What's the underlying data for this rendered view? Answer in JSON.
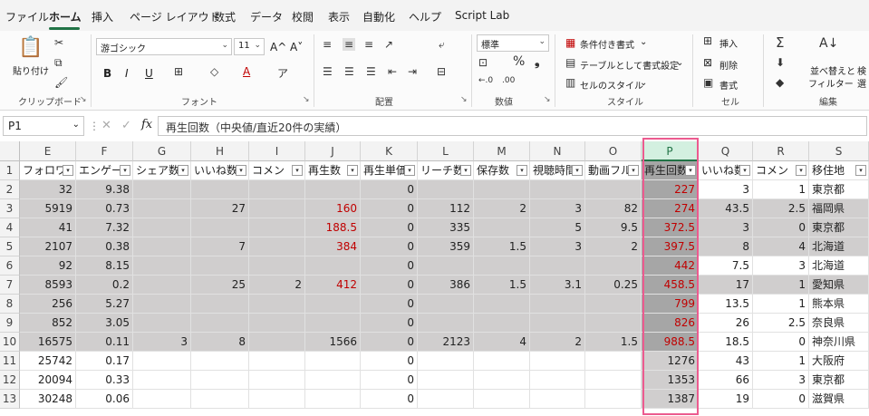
{
  "menu": [
    "ファイル",
    "ホーム",
    "挿入",
    "ページ レイアウト",
    "数式",
    "データ",
    "校閲",
    "表示",
    "自動化",
    "ヘルプ",
    "Script Lab"
  ],
  "menu_active": "ホーム",
  "ribbon": {
    "clipboard": {
      "label": "クリップボード",
      "paste": "貼り付け"
    },
    "font": {
      "label": "フォント",
      "name": "游ゴシック",
      "size": "11",
      "grow": "A^",
      "shrink": "A˅",
      "bold": "B",
      "italic": "I",
      "underline": "U"
    },
    "alignment": {
      "label": "配置"
    },
    "number": {
      "label": "数値",
      "format": "標準"
    },
    "styles": {
      "label": "スタイル",
      "cond": "条件付き書式",
      "table": "テーブルとして書式設定",
      "cell": "セルのスタイル"
    },
    "cells": {
      "label": "セル",
      "insert": "挿入",
      "delete": "削除",
      "format": "書式"
    },
    "editing": {
      "label": "編集",
      "sort1": "並べ替えと",
      "sort2": "フィルター",
      "find": "検",
      "find2": "選"
    }
  },
  "formula_bar": {
    "cell_ref": "P1",
    "fx": "fx",
    "content": "再生回数（中央値/直近20件の実績）"
  },
  "columns": [
    "E",
    "F",
    "G",
    "H",
    "I",
    "J",
    "K",
    "L",
    "M",
    "N",
    "O",
    "P",
    "Q",
    "R",
    "S"
  ],
  "selected_column": "P",
  "headers": [
    "フォロワ",
    "エンゲー",
    "シェア数",
    "いいね数",
    "コメン",
    "再生数",
    "再生単価",
    "リーチ数",
    "保存数",
    "視聴時間",
    "動画フル",
    "再生回数",
    "いいね数",
    "コメン",
    "移住地"
  ],
  "rows": [
    {
      "n": "1"
    },
    {
      "n": "2",
      "E": "32",
      "F": "9.38",
      "K": "0",
      "P": "227",
      "Q": "3",
      "R": "1",
      "S": "東京都"
    },
    {
      "n": "3",
      "E": "5919",
      "F": "0.73",
      "H": "27",
      "J": "160",
      "K": "0",
      "L": "112",
      "M": "2",
      "N": "3",
      "O": "82",
      "P": "274",
      "Q": "43.5",
      "R": "2.5",
      "S": "福岡県"
    },
    {
      "n": "4",
      "E": "41",
      "F": "7.32",
      "J": "188.5",
      "K": "0",
      "L": "335",
      "N": "5",
      "O": "9.5",
      "P": "372.5",
      "Q": "3",
      "R": "0",
      "S": "東京都"
    },
    {
      "n": "5",
      "E": "2107",
      "F": "0.38",
      "H": "7",
      "J": "384",
      "K": "0",
      "L": "359",
      "M": "1.5",
      "N": "3",
      "O": "2",
      "P": "397.5",
      "Q": "8",
      "R": "4",
      "S": "北海道"
    },
    {
      "n": "6",
      "E": "92",
      "F": "8.15",
      "K": "0",
      "P": "442",
      "Q": "7.5",
      "R": "3",
      "S": "北海道"
    },
    {
      "n": "7",
      "E": "8593",
      "F": "0.2",
      "H": "25",
      "I": "2",
      "J": "412",
      "K": "0",
      "L": "386",
      "M": "1.5",
      "N": "3.1",
      "O": "0.25",
      "P": "458.5",
      "Q": "17",
      "R": "1",
      "S": "愛知県"
    },
    {
      "n": "8",
      "E": "256",
      "F": "5.27",
      "K": "0",
      "P": "799",
      "Q": "13.5",
      "R": "1",
      "S": "熊本県"
    },
    {
      "n": "9",
      "E": "852",
      "F": "3.05",
      "K": "0",
      "P": "826",
      "Q": "26",
      "R": "2.5",
      "S": "奈良県"
    },
    {
      "n": "10",
      "E": "16575",
      "F": "0.11",
      "G": "3",
      "H": "8",
      "J": "1566",
      "K": "0",
      "L": "2123",
      "M": "4",
      "N": "2",
      "O": "1.5",
      "P": "988.5",
      "Q": "18.5",
      "R": "0",
      "S": "神奈川県"
    },
    {
      "n": "11",
      "E": "25742",
      "F": "0.17",
      "K": "0",
      "P": "1276",
      "Q": "43",
      "R": "1",
      "S": "大阪府"
    },
    {
      "n": "12",
      "E": "20094",
      "F": "0.33",
      "K": "0",
      "P": "1353",
      "Q": "66",
      "R": "3",
      "S": "東京都"
    },
    {
      "n": "13",
      "E": "30248",
      "F": "0.06",
      "K": "0",
      "P": "1387",
      "Q": "19",
      "R": "0",
      "S": "滋賀県"
    }
  ]
}
